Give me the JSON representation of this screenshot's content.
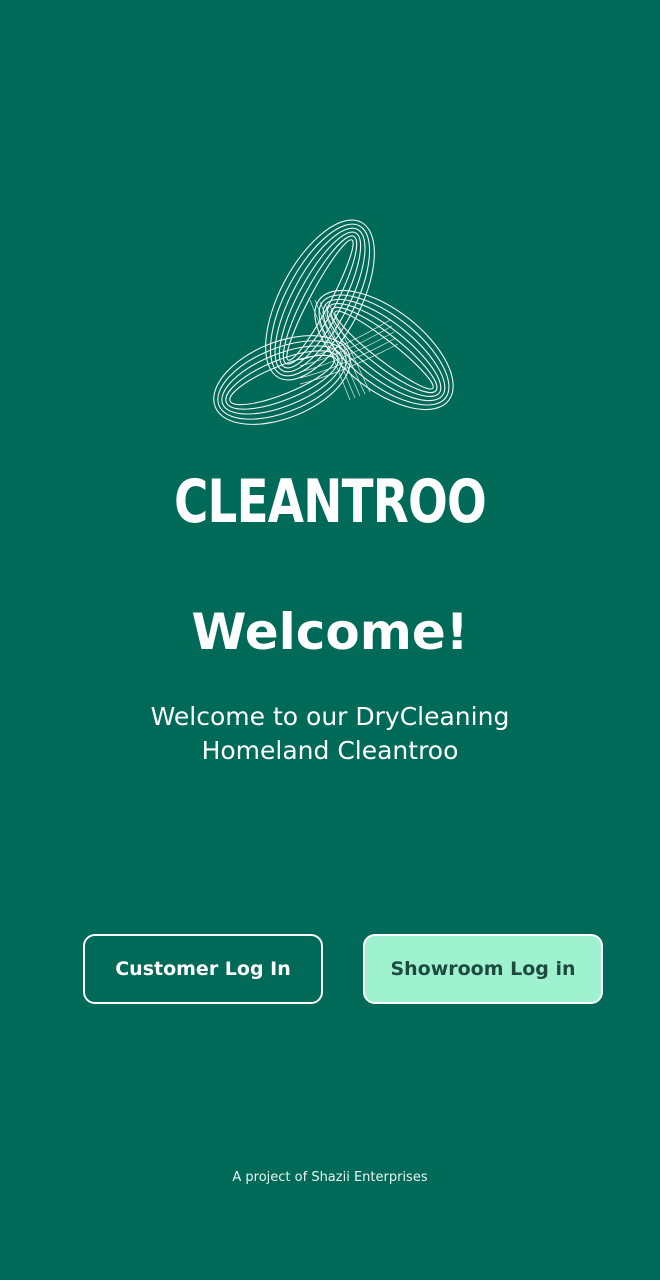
{
  "brand": {
    "logo_icon": "interlocking-rings-logo-icon",
    "name": "CLEANTROO"
  },
  "welcome": {
    "title": "Welcome!",
    "subtitle": "Welcome to our DryCleaning Homeland Cleantroo"
  },
  "actions": {
    "customer_login_label": "Customer Log In",
    "showroom_login_label": "Showroom Log in"
  },
  "footer": {
    "text": "A project of Shazii Enterprises"
  },
  "colors": {
    "background": "#006a58",
    "accent": "#9ff2d0",
    "text": "#ffffff"
  }
}
